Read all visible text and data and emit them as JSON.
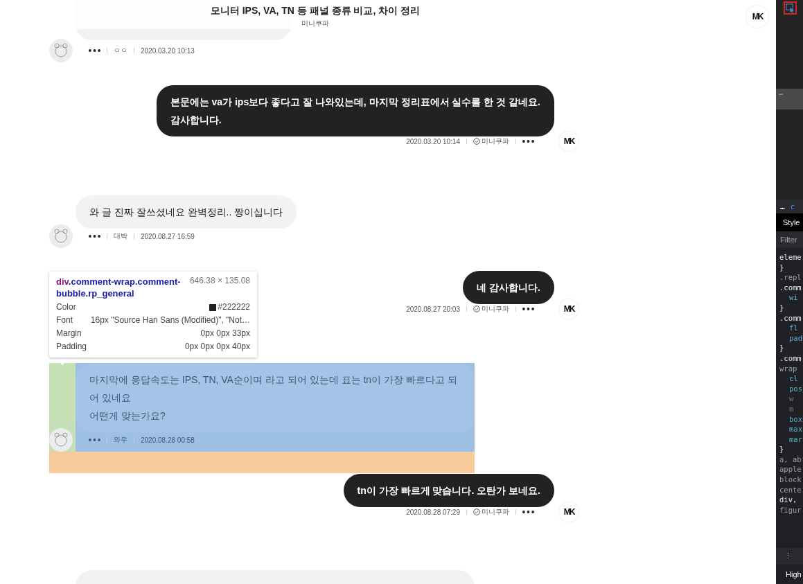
{
  "header": {
    "title": "모니터 IPS, VA, TN 등 패널 종류 비교, 차이 정리",
    "subtitle": "미니쿠파",
    "logo": "MK"
  },
  "comments": [
    {
      "kind": "stub_top",
      "nickname": "ㅇㅇ",
      "date": "2020.03.20 10:13",
      "highlighted": false
    },
    {
      "kind": "author",
      "text": "본문에는 va가 ips보다 좋다고 잘 나와있는데, 마지막 정리표에서 실수를 한 것 같네요.\n감사합니다.",
      "nickname": "미니쿠파",
      "date": "2020.03.20 10:14",
      "logo": "MK",
      "highlighted": false
    },
    {
      "kind": "visitor",
      "text": "와 글 진짜 잘쓰셨네요 완벽정리.. 짱이십니다",
      "nickname": "대박",
      "date": "2020.08.27 16:59",
      "highlighted": false
    },
    {
      "kind": "author",
      "text": "네 감사합니다.",
      "nickname": "미니쿠파",
      "date": "2020.08.27 20:03",
      "logo": "MK",
      "highlighted": false
    },
    {
      "kind": "visitor",
      "text": "마지막에 응답속도는 IPS, TN, VA순이며 라고 되어 있는데 표는 tn이 가장 빠르다고 되어 있네요\n어떤게 맞는가요?",
      "nickname": "와우",
      "date": "2020.08.28 00:58",
      "highlighted": true
    },
    {
      "kind": "author",
      "text": "tn이 가장 빠르게 맞습니다. 오탄가 보네요.",
      "nickname": "미니쿠파",
      "date": "2020.08.28 07:29",
      "logo": "MK",
      "highlighted": false
    },
    {
      "kind": "stub_bottom",
      "highlighted": false
    }
  ],
  "tooltip": {
    "tag": "div",
    "classes": ".comment-wrap.comment-bubble.rp_general",
    "size": "646.38 × 135.08",
    "rows": [
      {
        "label": "Color",
        "value": "#222222",
        "kind": "color"
      },
      {
        "label": "Font",
        "value": "16px \"Source Han Sans (Modified)\", \"Not…",
        "kind": "text"
      },
      {
        "label": "Margin",
        "value": "0px 0px 33px",
        "kind": "text"
      },
      {
        "label": "Padding",
        "value": "0px 0px 0px 40px",
        "kind": "text"
      }
    ]
  },
  "devtools": {
    "inspect_active": true,
    "selected_row": "…",
    "breadcrumb": [
      "…",
      "c"
    ],
    "tab": "Style",
    "filter_placeholder": "Filter",
    "code_lines": [
      {
        "text": "eleme",
        "kind": "selector"
      },
      {
        "text": "}",
        "kind": "selector"
      },
      {
        "text": ".repl",
        "kind": "inactive"
      },
      {
        "text": ".comm",
        "kind": "selector"
      },
      {
        "text": "wi",
        "kind": "prop"
      },
      {
        "text": "}",
        "kind": "selector"
      },
      {
        "text": ".comm",
        "kind": "selector"
      },
      {
        "text": "fl",
        "kind": "prop"
      },
      {
        "text": "pad",
        "kind": "prop"
      },
      {
        "text": "}",
        "kind": "selector"
      },
      {
        "text": ".comm",
        "kind": "selector"
      },
      {
        "text": "wrap",
        "kind": "inactive"
      },
      {
        "text": "cl",
        "kind": "prop"
      },
      {
        "text": "pos",
        "kind": "prop"
      },
      {
        "text": "w",
        "kind": "struck"
      },
      {
        "text": "m",
        "kind": "struck"
      },
      {
        "text": "box",
        "kind": "prop"
      },
      {
        "text": "max",
        "kind": "prop"
      },
      {
        "text": "mar",
        "kind": "prop"
      },
      {
        "text": "}",
        "kind": "selector"
      },
      {
        "text": "a, ab",
        "kind": "inactive"
      },
      {
        "text": "apple",
        "kind": "inactive"
      },
      {
        "text": "block",
        "kind": "inactive"
      },
      {
        "text": "cente",
        "kind": "inactive"
      },
      {
        "text": "div,",
        "kind": "selector"
      },
      {
        "text": "figur",
        "kind": "inactive"
      }
    ],
    "menu_glyph": "⋮",
    "drawer_tab": "High"
  }
}
